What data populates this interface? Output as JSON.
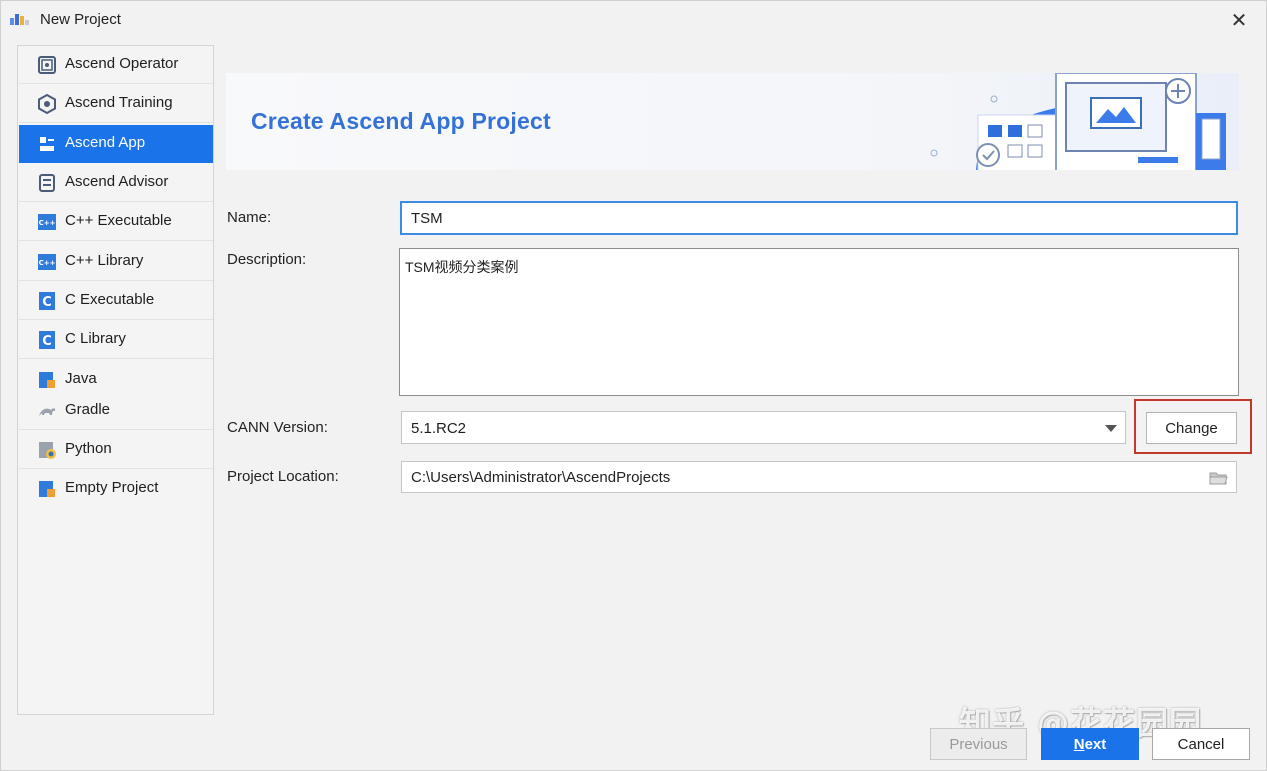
{
  "window": {
    "title": "New Project",
    "close_glyph": "✕"
  },
  "sidebar": {
    "items": [
      {
        "label": "Ascend Operator",
        "icon": "ascend-operator-icon"
      },
      {
        "label": "Ascend Training",
        "icon": "ascend-training-icon"
      },
      {
        "label": "Ascend App",
        "icon": "ascend-app-icon",
        "selected": true
      },
      {
        "label": "Ascend Advisor",
        "icon": "ascend-advisor-icon"
      },
      {
        "label": "C++ Executable",
        "icon": "cpp-executable-icon"
      },
      {
        "label": "C++ Library",
        "icon": "cpp-library-icon"
      },
      {
        "label": "C Executable",
        "icon": "c-executable-icon"
      },
      {
        "label": "C Library",
        "icon": "c-library-icon"
      },
      {
        "label": "Java",
        "icon": "java-icon"
      },
      {
        "label": "Gradle",
        "icon": "gradle-icon"
      },
      {
        "label": "Python",
        "icon": "python-icon"
      },
      {
        "label": "Empty Project",
        "icon": "empty-project-icon"
      }
    ]
  },
  "banner": {
    "title": "Create Ascend App Project"
  },
  "form": {
    "name_label": "Name:",
    "name_value": "TSM",
    "description_label": "Description:",
    "description_value": "TSM视频分类案例",
    "cann_label": "CANN Version:",
    "cann_value": "5.1.RC2",
    "change_label": "Change",
    "location_label": "Project Location:",
    "location_value": "C:\\Users\\Administrator\\AscendProjects"
  },
  "footer": {
    "previous_label": "Previous",
    "next_mnemonic": "N",
    "next_rest": "ext",
    "cancel_label": "Cancel"
  },
  "watermark": "知乎 @花花园园",
  "colors": {
    "accent": "#1a73e8",
    "banner_title": "#3572d8",
    "highlight": "#c0392b"
  }
}
